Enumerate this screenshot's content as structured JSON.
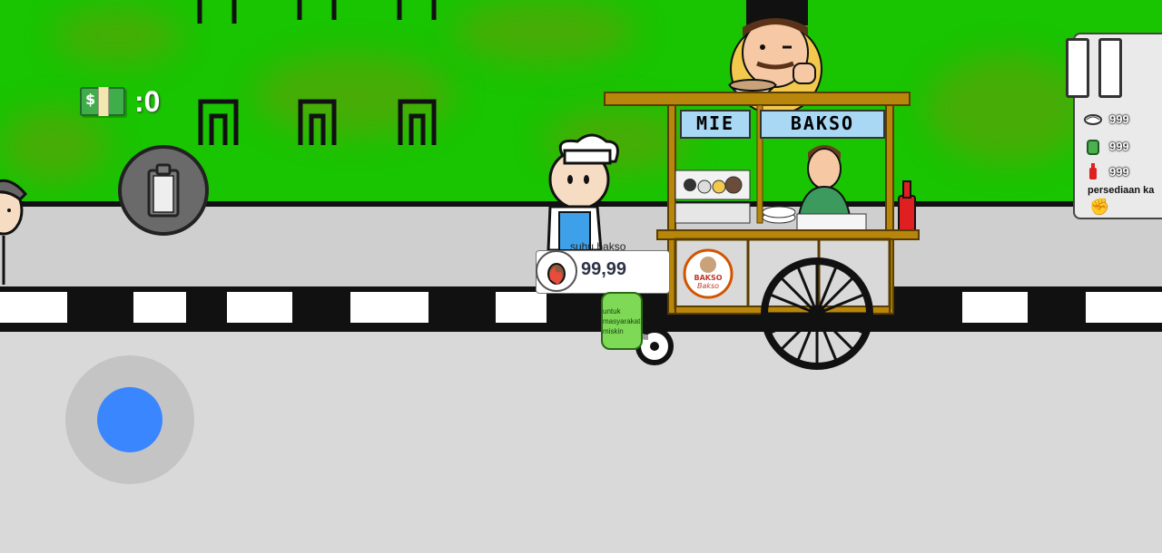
{
  "hud": {
    "money_label": ":0",
    "money_icon": "money-bill-icon",
    "clipboard_icon": "clipboard-icon"
  },
  "cart": {
    "sign_left": "MIE",
    "sign_right": "BAKSO",
    "logo_line1": "BAKSO",
    "logo_line2": "Bakso"
  },
  "popup": {
    "label": "suhu bakso",
    "value": "99,99",
    "icon": "meatball-fire-icon"
  },
  "gas_tank": {
    "text_lines": [
      "untuk",
      "masyarakat",
      "miskin"
    ]
  },
  "inventory": {
    "items": [
      {
        "icon": "noodle-icon",
        "value": "999"
      },
      {
        "icon": "gas-can-icon",
        "value": "999"
      },
      {
        "icon": "sauce-bottle-icon",
        "value": "999"
      }
    ],
    "label": "persediaan ka",
    "hand_icon": "hand-icon"
  },
  "colors": {
    "grass": "#19c400",
    "joystick_knob": "#3a86ff",
    "cart_wood": "#b8860b",
    "sign_bg": "#a9d8f5"
  }
}
